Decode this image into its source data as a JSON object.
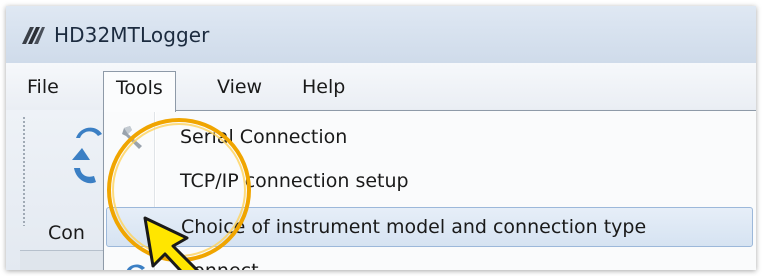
{
  "window": {
    "title": "HD32MTLogger"
  },
  "menubar": {
    "items": [
      "File",
      "Tools",
      "View",
      "Help"
    ]
  },
  "toolbar": {
    "connect_label": "Con"
  },
  "tools_menu": {
    "items": [
      {
        "label": "Serial Connection",
        "icon": "wrench-icon"
      },
      {
        "label": "TCP/IP connection setup",
        "icon": ""
      },
      {
        "label": "Choice of instrument model and connection type",
        "icon": "",
        "highlighted": true
      },
      {
        "label": "Connect",
        "icon": "connect-icon"
      }
    ]
  },
  "colors": {
    "highlight": "#d6e3f2",
    "callout_ring": "#f0a500",
    "pointer_fill": "#ffe600"
  }
}
